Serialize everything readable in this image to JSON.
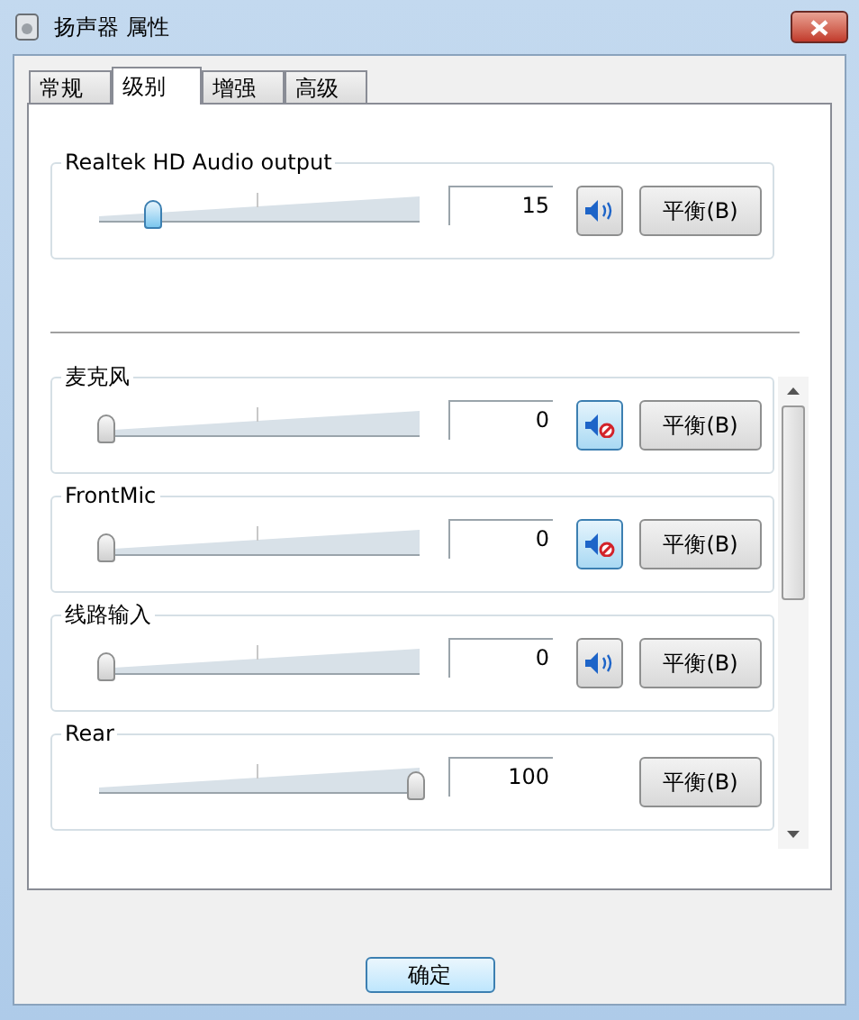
{
  "window": {
    "title": "扬声器 属性"
  },
  "tabs": [
    {
      "label": "常规",
      "selected": false
    },
    {
      "label": "级别",
      "selected": true
    },
    {
      "label": "增强",
      "selected": false
    },
    {
      "label": "高级",
      "selected": false
    }
  ],
  "master": {
    "name": "Realtek HD Audio output",
    "level": 0.15,
    "value": "15",
    "muted": false,
    "balance": "平衡(B)"
  },
  "channels": [
    {
      "name": "麦克风",
      "level": 0,
      "value": "0",
      "muted": true,
      "balance": "平衡(B)"
    },
    {
      "name": "FrontMic",
      "level": 0,
      "value": "0",
      "muted": true,
      "balance": "平衡(B)"
    },
    {
      "name": "线路输入",
      "level": 0,
      "value": "0",
      "muted": false,
      "balance": "平衡(B)"
    },
    {
      "name": "Rear",
      "level": 1,
      "value": "100",
      "balance": "平衡(B)"
    }
  ],
  "buttons": [
    "确定"
  ]
}
